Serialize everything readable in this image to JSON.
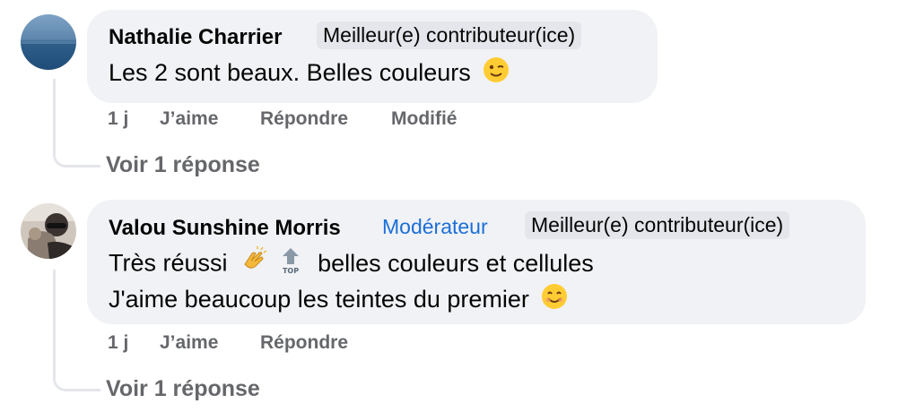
{
  "comments": [
    {
      "author": "Nathalie Charrier",
      "badges": [
        "Meilleur(e) contributeur(ice)"
      ],
      "lines": [
        "Les 2 sont beaux. Belles couleurs"
      ],
      "emoji_icons": [
        "winking-face-emoji"
      ],
      "actions": {
        "time": "1 j",
        "like": "J’aime",
        "reply": "Répondre",
        "edited": "Modifié"
      },
      "replies_link": "Voir 1 réponse"
    },
    {
      "author": "Valou Sunshine Morris",
      "role_badge": "Modérateur",
      "badges": [
        "Meilleur(e) contributeur(ice)"
      ],
      "lines": [
        "Très réussi",
        "belles couleurs et cellules",
        "J'aime beaucoup les teintes du premier"
      ],
      "emoji_icons": [
        "clapping-hands-emoji",
        "top-arrow-emoji",
        "smiling-face-emoji"
      ],
      "top_emoji_label": "TOP",
      "actions": {
        "time": "1 j",
        "like": "J’aime",
        "reply": "Répondre"
      },
      "replies_link": "Voir 1 réponse"
    }
  ],
  "colors": {
    "bubble_bg": "#f0f2f5",
    "badge_bg": "#e4e6eb",
    "moderator_blue": "#1b6fd8",
    "secondary_text": "#65676b"
  }
}
